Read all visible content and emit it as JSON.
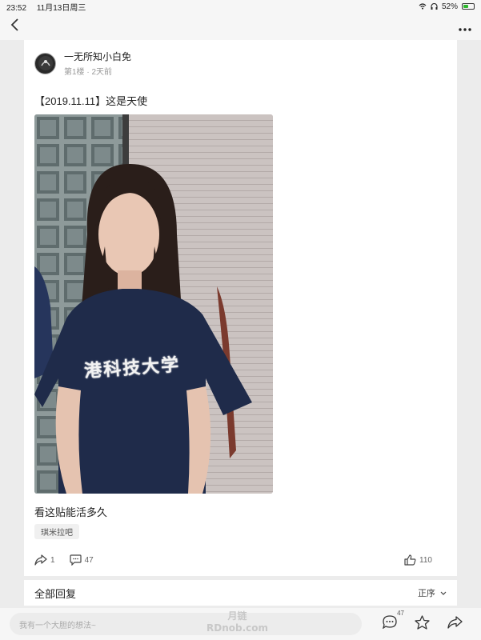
{
  "status_bar": {
    "time": "23:52",
    "date": "11月13日周三",
    "battery": "52%",
    "battery_level": 0.52
  },
  "post": {
    "author_name": "一无所知小白免",
    "floor": "第1楼",
    "time_ago": "2天前",
    "title": "【2019.11.11】这是天使",
    "shirt_text": "港科技大学",
    "body": "看这贴能活多久",
    "forum_tag": "琪米拉吧",
    "share_count": "1",
    "comment_count": "47",
    "like_count": "110"
  },
  "replies": {
    "title": "全部回复",
    "sort_label": "正序"
  },
  "bottom_bar": {
    "input_placeholder": "我有一个大胆的想法~",
    "comment_badge": "47"
  },
  "watermark": {
    "line1": "月链",
    "line2": "RDnob.com"
  },
  "colors": {
    "page_bg": "#ececec",
    "card_bg": "#ffffff",
    "battery_green": "#2eb82e",
    "shirt_navy": "#1f2b4a"
  }
}
